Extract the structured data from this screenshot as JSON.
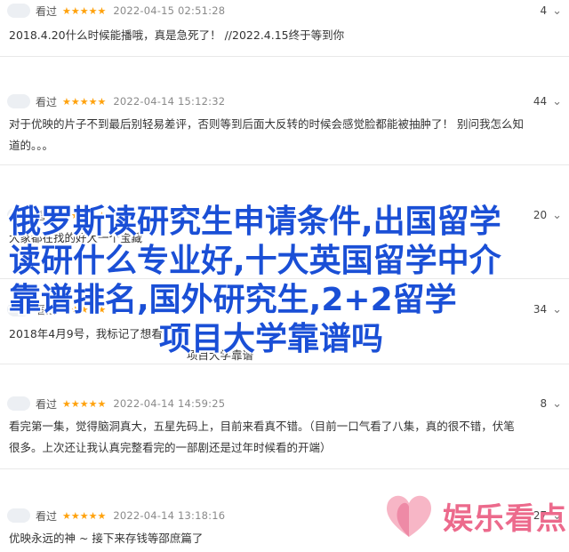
{
  "comments": [
    {
      "user": "看过",
      "stars": "★★★★★",
      "time": "2022-04-15 02:51:28",
      "votes": "4",
      "text": [
        "2018.4.20什么时候能播哦，真是急死了！ //2022.4.15终于等到你"
      ]
    },
    {
      "user": "看过",
      "stars": "★★★★★",
      "time": "2022-04-14 15:12:32",
      "votes": "44",
      "text": [
        "对于优映的片子不到最后别轻易差评，否则等到后面大反转的时候会感觉脸都能被抽肿了！ 别问我怎么知",
        "道的。。。"
      ]
    },
    {
      "user": "看过",
      "stars": "★★★★★",
      "time": "",
      "votes": "20",
      "text": [
        "",
        "大家都在找的好大一个宝藏"
      ]
    },
    {
      "user": "看过",
      "stars": "★★★★★",
      "time": "",
      "votes": "34",
      "text": [
        "2018年4月9号，我标记了想看，",
        "项目大学靠谱"
      ]
    },
    {
      "user": "看过",
      "stars": "★★★★★",
      "time": "2022-04-14 14:59:25",
      "votes": "8",
      "text": [
        "看完第一集，觉得脑洞真大，五星先码上，目前来看真不错。（目前一口气看了八集，真的很不错，伏笔",
        "很多。上次还让我认真完整看完的一部剧还是过年时候看的开端）"
      ]
    },
    {
      "user": "看过",
      "stars": "★★★★★",
      "time": "2022-04-14 13:18:16",
      "votes": "27",
      "text": [
        "优映永远的神 ~ 接下来存钱等邵庶篇了"
      ]
    }
  ],
  "overlay_title": {
    "lines": [
      "俄罗斯读研究生申请条件,出国留学",
      "读研什么专业好,十大英国留学中介",
      "靠谱排名,国外研究生,2+2留学",
      "项目大学靠谱吗"
    ]
  },
  "watermark": {
    "text": "娱乐看点",
    "color": "#ec6a8c"
  },
  "colors": {
    "star": "#ffa20d",
    "overlay_text": "#1a4fd6"
  }
}
